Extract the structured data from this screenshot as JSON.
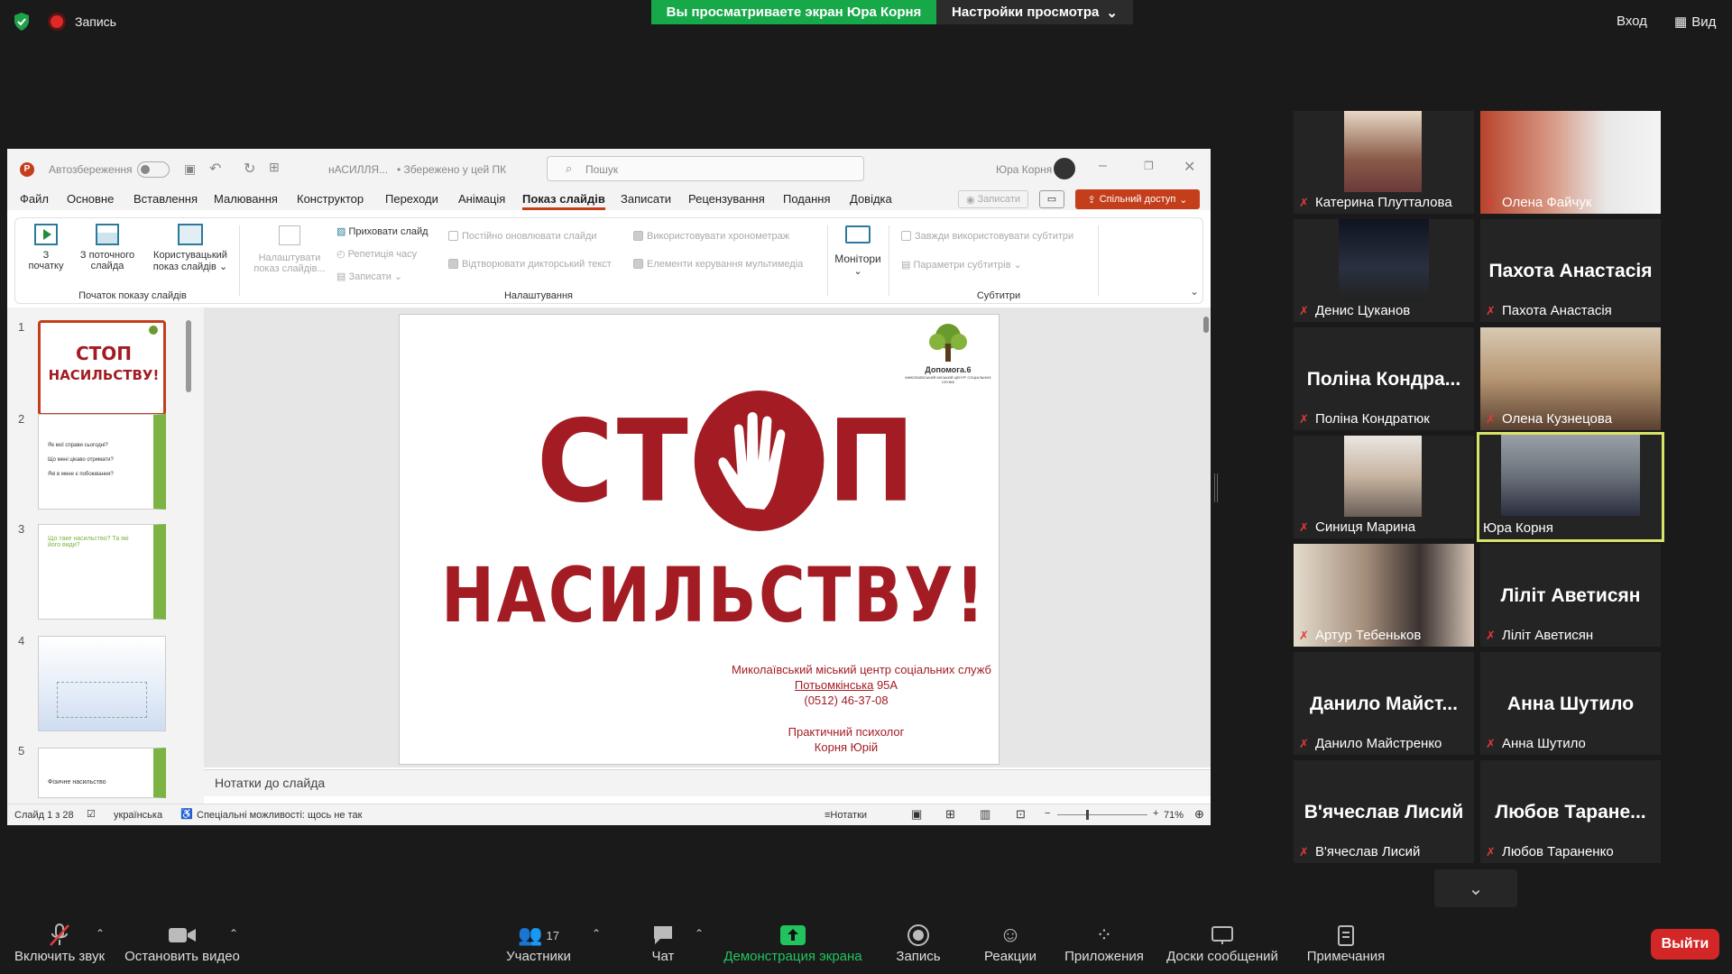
{
  "topbar": {
    "recording_label": "Запись",
    "share_banner": "Вы просматриваете экран Юра Корня",
    "view_settings": "Настройки просмотра",
    "enter_label": "Вход",
    "view_label": "Вид"
  },
  "ppt": {
    "autosave_label": "Автозбереження",
    "doc_title": "нАСИЛЛЯ...",
    "saved_label": "• Збережено у цей ПК",
    "search_placeholder": "Пошук",
    "user_name": "Юра Корня",
    "tabs": [
      "Файл",
      "Основне",
      "Вставлення",
      "Малювання",
      "Конструктор",
      "Переходи",
      "Анімація",
      "Показ слайдів",
      "Записати",
      "Рецензування",
      "Подання",
      "Довідка"
    ],
    "active_tab": "Показ слайдів",
    "record_btn": "Записати",
    "share_btn": "Спільний доступ",
    "ribbon": {
      "from_start_1": "З",
      "from_start_2": "початку",
      "from_current_1": "З поточного",
      "from_current_2": "слайда",
      "custom_1": "Користувацький",
      "custom_2": "показ слайдів",
      "group_start": "Початок показу слайдів",
      "hide_slide": "Приховати слайд",
      "setup_1": "Налаштувати",
      "setup_2": "показ слайдів...",
      "rehearse": "Репетиція часу",
      "record": "Записати",
      "keep_updated": "Постійно оновлювати слайди",
      "play_narration": "Відтворювати дикторський текст",
      "use_timings": "Використовувати хронометраж",
      "media_controls": "Елементи керування мультимедіа",
      "group_setup": "Налаштування",
      "monitors": "Монітори",
      "always_subtitles": "Завжди використовувати субтитри",
      "subtitle_settings": "Параметри субтитрів",
      "group_subtitles": "Субтитри"
    },
    "thumbs": [
      {
        "n": "1"
      },
      {
        "n": "2",
        "lines": [
          "Як мої справи сьогодні?",
          "Що мені цікаво отримати?",
          "Які в мене є побоювання?"
        ]
      },
      {
        "n": "3",
        "title": "Що таке насильство? Та які його види?"
      },
      {
        "n": "4"
      },
      {
        "n": "5",
        "title": "Фізичне насильство"
      }
    ],
    "slide": {
      "stop_line": "СТОП",
      "stop_left": "СТ",
      "stop_right": "П",
      "violence_line": "НАСИЛЬСТВУ!",
      "logo_name": "Допомога.6",
      "logo_sub": "МИКОЛАЇВСЬКИЙ МІСЬКИЙ ЦЕНТР СОЦІАЛЬНИХ СЛУЖБ",
      "org": "Миколаївський міський центр соціальних служб",
      "street": "Потьомкінська",
      "house": " 95А",
      "phone": "(0512) 46-37-08",
      "role": "Практичний психолог",
      "author": "Корня Юрій"
    },
    "notes_placeholder": "Нотатки до слайда",
    "status": {
      "slide_of": "Слайд 1 з 28",
      "language": "українська",
      "accessibility": "Спеціальні можливості: щось не так",
      "notes": "Нотатки",
      "zoom": "71%"
    }
  },
  "participants": [
    {
      "name": "Катерина Плутталова",
      "video": true
    },
    {
      "name": "Олена Файчук",
      "video": true
    },
    {
      "name": "Денис Цуканов",
      "video": true
    },
    {
      "name": "Пахота Анастасія",
      "big": "Пахота Анастасія",
      "video": false
    },
    {
      "name": "Поліна Кондратюк",
      "big": "Поліна Кондра...",
      "video": false
    },
    {
      "name": "Олена Кузнецова",
      "video": true
    },
    {
      "name": "Синиця Марина",
      "video": true
    },
    {
      "name": "Юра Корня",
      "video": true,
      "active": true
    },
    {
      "name": "Артур Тебеньков",
      "video": true
    },
    {
      "name": "Ліліт Аветисян",
      "big": "Ліліт Аветисян",
      "video": false
    },
    {
      "name": "Данило Майстренко",
      "big": "Данило Майст...",
      "video": false
    },
    {
      "name": "Анна Шутило",
      "big": "Анна Шутило",
      "video": false
    },
    {
      "name": "В'ячеслав Лисий",
      "big": "В'ячеслав Лисий",
      "video": false
    },
    {
      "name": "Любов Тараненко",
      "big": "Любов Таране...",
      "video": false
    }
  ],
  "bottombar": {
    "unmute": "Включить звук",
    "stop_video": "Остановить видео",
    "participants": "Участники",
    "participants_count": "17",
    "chat": "Чат",
    "share_screen": "Демонстрация экрана",
    "record": "Запись",
    "reactions": "Реакции",
    "apps": "Приложения",
    "whiteboards": "Доски сообщений",
    "notes": "Примечания",
    "leave": "Выйти"
  },
  "colors": {
    "share_green": "#17a84a",
    "ppt_accent": "#c43e1c",
    "stop_red": "#a31c24",
    "leave_red": "#d32626",
    "active_border": "#d8e36a"
  }
}
